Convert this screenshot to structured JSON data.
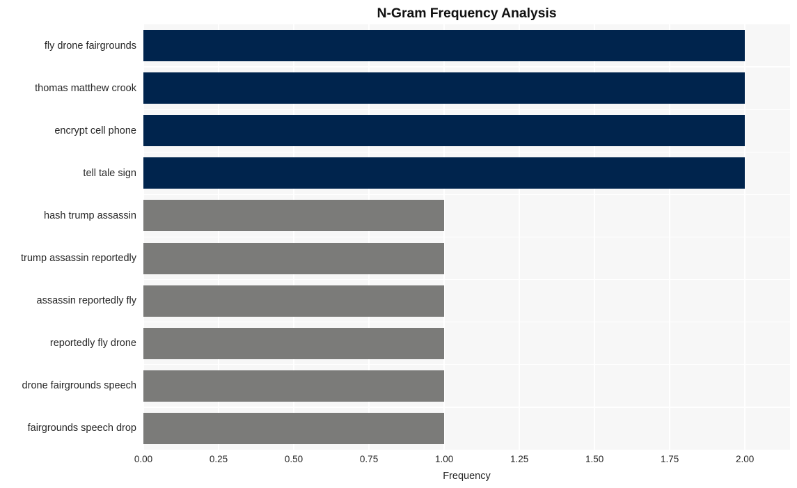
{
  "chart_data": {
    "type": "bar",
    "orientation": "horizontal",
    "title": "N-Gram Frequency Analysis",
    "xlabel": "Frequency",
    "ylabel": "",
    "categories": [
      "fly drone fairgrounds",
      "thomas matthew crook",
      "encrypt cell phone",
      "tell tale sign",
      "hash trump assassin",
      "trump assassin reportedly",
      "assassin reportedly fly",
      "reportedly fly drone",
      "drone fairgrounds speech",
      "fairgrounds speech drop"
    ],
    "values": [
      2,
      2,
      2,
      2,
      1,
      1,
      1,
      1,
      1,
      1
    ],
    "bar_colors": [
      "#00244d",
      "#00244d",
      "#00244d",
      "#00244d",
      "#7b7b79",
      "#7b7b79",
      "#7b7b79",
      "#7b7b79",
      "#7b7b79",
      "#7b7b79"
    ],
    "xlim": [
      0,
      2.15
    ],
    "xticks": [
      0,
      0.25,
      0.5,
      0.75,
      1,
      1.25,
      1.5,
      1.75,
      2
    ],
    "xtick_labels": [
      "0.00",
      "0.25",
      "0.50",
      "0.75",
      "1.00",
      "1.25",
      "1.50",
      "1.75",
      "2.00"
    ],
    "grid": true,
    "grid_color": "#ffffff",
    "plot_background": "#f7f7f7",
    "figure_background": "#ffffff",
    "legend": null,
    "accent_primary": "#00244d",
    "accent_secondary": "#7b7b79"
  }
}
